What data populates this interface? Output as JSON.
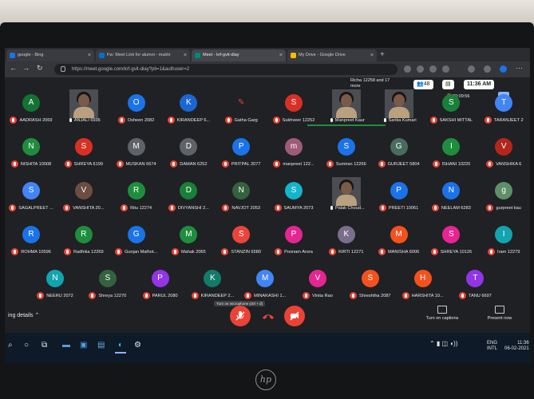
{
  "browser": {
    "tabs": [
      {
        "label": "google - Bing",
        "color": "#1a73e8"
      },
      {
        "label": "Fw: Meet Link for alumni - mukhi",
        "color": "#0072c6"
      },
      {
        "label": "Meet - krf-gvit-diay",
        "color": "#00897b",
        "active": true
      },
      {
        "label": "My Drive - Google Drive",
        "color": "#fbbc04"
      }
    ],
    "url": "https://meet.google.com/krf-gvit-diay?pli=1&authuser=2"
  },
  "meet": {
    "participants_info": "Richa 12258 and 17 more",
    "people_count": "48",
    "chat_icon": "chat-icon",
    "time": "11:36 AM",
    "recording_time": "00:09:56",
    "grid": [
      [
        {
          "letter": "A",
          "name": "AADRASH 2069",
          "color": "#137333"
        },
        {
          "letter": "",
          "name": "ANJALI 6936",
          "camera": true
        },
        {
          "letter": "O",
          "name": "Osheen 2082",
          "color": "#1a73e8"
        },
        {
          "letter": "K",
          "name": "KIRANDEEP 6...",
          "color": "#1967d2"
        },
        {
          "letter": "",
          "name": "Gatha Garg",
          "color": "#202124"
        },
        {
          "letter": "S",
          "name": "Sukhveer 12252",
          "color": "#d93025"
        },
        {
          "letter": "",
          "name": "Manpreet Kaur",
          "camera": true,
          "speaking": true
        },
        {
          "letter": "",
          "name": "Sarika Kumari",
          "camera": true
        },
        {
          "letter": "S",
          "name": "SAKSHI MITTAL",
          "color": "#188038"
        },
        {
          "letter": "T",
          "name": "TARANJEET 2",
          "color": "#4285f4"
        }
      ],
      [
        {
          "letter": "N",
          "name": "NISHITA 10008",
          "color": "#1e8e3e"
        },
        {
          "letter": "S",
          "name": "SHREYA 6199",
          "color": "#d93025"
        },
        {
          "letter": "M",
          "name": "MUSKAN 6674",
          "color": "#5f6368"
        },
        {
          "letter": "D",
          "name": "DAMAN 6252",
          "color": "#5f6368"
        },
        {
          "letter": "P",
          "name": "PRITPAL 2077",
          "color": "#1a73e8"
        },
        {
          "letter": "m",
          "name": "manpreet 122...",
          "color": "#9e5b7a"
        },
        {
          "letter": "S",
          "name": "Sumiran 12266",
          "color": "#1a73e8"
        },
        {
          "letter": "G",
          "name": "GURJEET 5804",
          "color": "#4a6b5d"
        },
        {
          "letter": "I",
          "name": "ISHANI 10220",
          "color": "#1e8e3e"
        },
        {
          "letter": "V",
          "name": "VANSHIKA 6",
          "color": "#b3261e"
        }
      ],
      [
        {
          "letter": "S",
          "name": "SAGALPREET ...",
          "color": "#4285f4"
        },
        {
          "letter": "V",
          "name": "VANSHITA 20...",
          "color": "#6d4c41"
        },
        {
          "letter": "R",
          "name": "Ritu 12274",
          "color": "#1e8e3e"
        },
        {
          "letter": "D",
          "name": "DIVYANSHI 2...",
          "color": "#188038"
        },
        {
          "letter": "N",
          "name": "NAVJOT 2053",
          "color": "#34623f"
        },
        {
          "letter": "S",
          "name": "SAUMYA 2073",
          "color": "#12b5cb"
        },
        {
          "letter": "",
          "name": "Palak Choud...",
          "camera": true
        },
        {
          "letter": "P",
          "name": "PREETI 10061",
          "color": "#1a73e8"
        },
        {
          "letter": "N",
          "name": "NEELAM 6283",
          "color": "#1a73e8"
        },
        {
          "letter": "g",
          "name": "gurpreet kau",
          "color": "#5f8f6a"
        }
      ],
      [
        {
          "letter": "R",
          "name": "ROHMA 10596",
          "color": "#1a73e8"
        },
        {
          "letter": "R",
          "name": "Radhika 12269",
          "color": "#1e8e3e"
        },
        {
          "letter": "G",
          "name": "Gunjan Malhot...",
          "color": "#1a73e8"
        },
        {
          "letter": "M",
          "name": "Mahak 2065",
          "color": "#1e8e3e"
        },
        {
          "letter": "S",
          "name": "STANZIN 6580",
          "color": "#e8453c"
        },
        {
          "letter": "P",
          "name": "Poonam Arora",
          "color": "#e52592"
        },
        {
          "letter": "K",
          "name": "KIRTI 12271",
          "color": "#7b6e8a"
        },
        {
          "letter": "M",
          "name": "MANISHA 6006",
          "color": "#f4511e"
        },
        {
          "letter": "S",
          "name": "SHREYA 10126",
          "color": "#e52592"
        },
        {
          "letter": "I",
          "name": "Iram 12279",
          "color": "#12a4af"
        }
      ],
      [
        {
          "letter": "N",
          "name": "NEERU 2072",
          "color": "#12a4af"
        },
        {
          "letter": "S",
          "name": "Shreya 12270",
          "color": "#34623f"
        },
        {
          "letter": "P",
          "name": "PARUL 2080",
          "color": "#9334e6"
        },
        {
          "letter": "K",
          "name": "KIRANDEEP 2...",
          "color": "#137b6a"
        },
        {
          "letter": "M",
          "name": "MINAKASHI 1...",
          "color": "#4285f4"
        },
        {
          "letter": "V",
          "name": "Vinita Rao",
          "color": "#e52592"
        },
        {
          "letter": "S",
          "name": "Shreshtha 2087",
          "color": "#f4511e"
        },
        {
          "letter": "H",
          "name": "HARSHITA 10...",
          "color": "#f4511e"
        },
        {
          "letter": "T",
          "name": "TANU 6697",
          "color": "#9334e6"
        }
      ]
    ],
    "bottom": {
      "details_label": "ing details",
      "tooltip": "Turn on microphone (ctrl + d)",
      "captions_label": "Turn on captions",
      "present_label": "Present now"
    }
  },
  "taskbar": {
    "lang": "ENG",
    "region": "INTL",
    "time": "11:36",
    "date": "06-02-2021"
  },
  "brand": "hp"
}
